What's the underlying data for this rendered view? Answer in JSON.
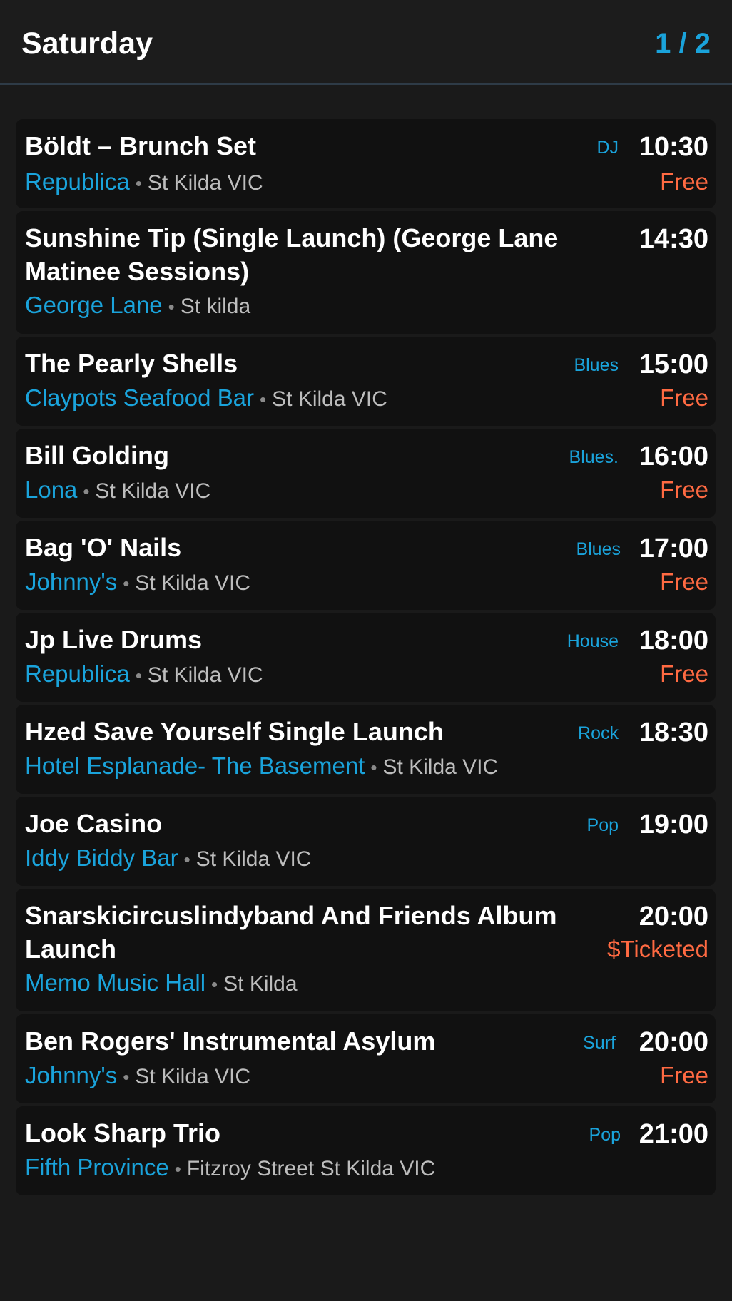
{
  "header": {
    "day": "Saturday",
    "page_indicator": "1 / 2"
  },
  "events": [
    {
      "title": "Böldt – Brunch Set",
      "venue": "Republica",
      "location": "St Kilda VIC",
      "genre": "DJ",
      "time": "10:30",
      "price": "Free"
    },
    {
      "title": "Sunshine Tip (Single Launch) (George Lane Matinee Sessions)",
      "venue": "George Lane",
      "location": "St kilda",
      "genre": "",
      "time": "14:30",
      "price": ""
    },
    {
      "title": "The Pearly Shells",
      "venue": "Claypots Seafood Bar",
      "location": "St Kilda VIC",
      "genre": "Blues",
      "time": "15:00",
      "price": "Free"
    },
    {
      "title": "Bill Golding",
      "venue": "Lona",
      "location": "St Kilda VIC",
      "genre": "Blues.",
      "time": "16:00",
      "price": "Free"
    },
    {
      "title": "Bag 'O' Nails",
      "venue": "Johnny's",
      "location": "St Kilda VIC",
      "genre": "Blues",
      "time": "17:00",
      "price": "Free"
    },
    {
      "title": "Jp Live Drums",
      "venue": "Republica",
      "location": "St Kilda VIC",
      "genre": "House",
      "time": "18:00",
      "price": "Free"
    },
    {
      "title": "Hzed Save Yourself Single Launch",
      "venue": "Hotel Esplanade- The Basement",
      "location": "St Kilda VIC",
      "genre": "Rock",
      "time": "18:30",
      "price": ""
    },
    {
      "title": "Joe Casino",
      "venue": "Iddy Biddy Bar",
      "location": "St Kilda VIC",
      "genre": "Pop",
      "time": "19:00",
      "price": ""
    },
    {
      "title": "Snarskicircuslindyband And Friends Album Launch",
      "venue": "Memo Music Hall",
      "location": "St Kilda",
      "genre": "",
      "time": "20:00",
      "price": "$Ticketed"
    },
    {
      "title": "Ben Rogers' Instrumental Asylum",
      "venue": "Johnny's",
      "location": "St Kilda VIC",
      "genre": "Surf",
      "time": "20:00",
      "price": "Free"
    },
    {
      "title": "Look Sharp Trio",
      "venue": "Fifth Province",
      "location": "Fitzroy Street St Kilda VIC",
      "genre": "Pop",
      "time": "21:00",
      "price": ""
    }
  ],
  "colors": {
    "background": "#1a1a1a",
    "card": "#111111",
    "accent": "#1aa3db",
    "price": "#ff6a42",
    "location": "#bdbdbd"
  }
}
